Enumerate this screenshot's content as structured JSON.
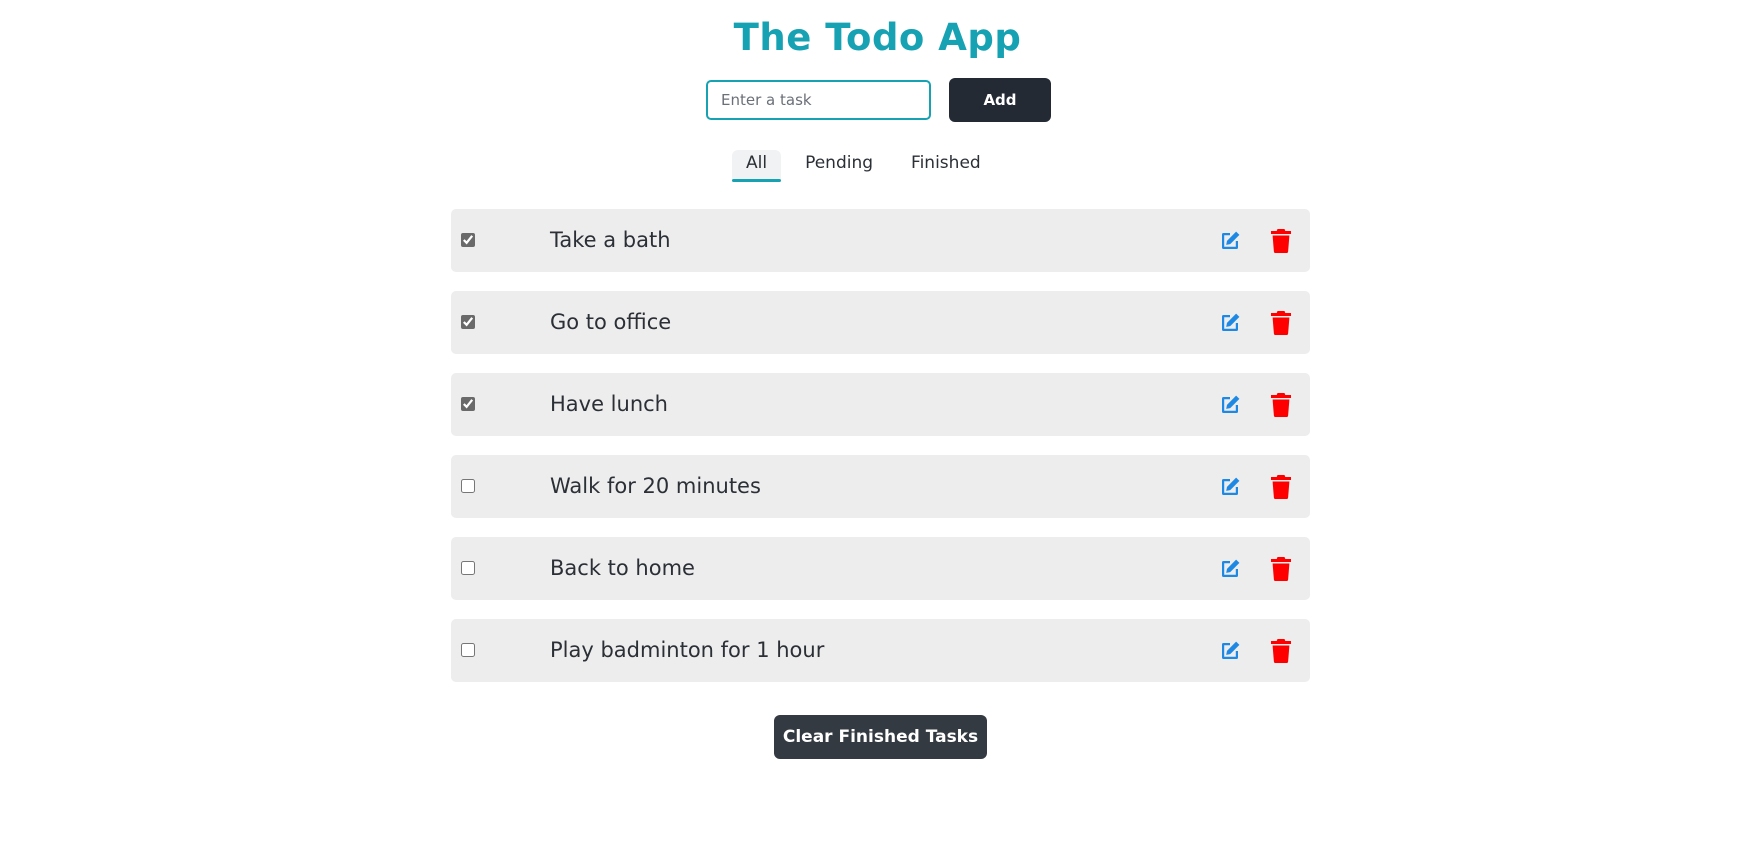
{
  "app": {
    "title": "The Todo App"
  },
  "add_form": {
    "input_placeholder": "Enter a task",
    "input_value": "",
    "add_label": "Add"
  },
  "filters": [
    {
      "label": "All",
      "active": true
    },
    {
      "label": "Pending",
      "active": false
    },
    {
      "label": "Finished",
      "active": false
    }
  ],
  "tasks": [
    {
      "text": "Take a bath",
      "done": true
    },
    {
      "text": "Go to office",
      "done": true
    },
    {
      "text": "Have lunch",
      "done": true
    },
    {
      "text": "Walk for 20 minutes",
      "done": false
    },
    {
      "text": "Back to home",
      "done": false
    },
    {
      "text": "Play badminton for 1 hour",
      "done": false
    }
  ],
  "icons": {
    "edit": "edit-icon",
    "delete": "trash-icon"
  },
  "colors": {
    "accent": "#17a2b3",
    "edit": "#1e88e5",
    "delete": "#ff0000",
    "dark_button": "#232a34"
  },
  "actions": {
    "clear_label": "Clear Finished Tasks"
  }
}
